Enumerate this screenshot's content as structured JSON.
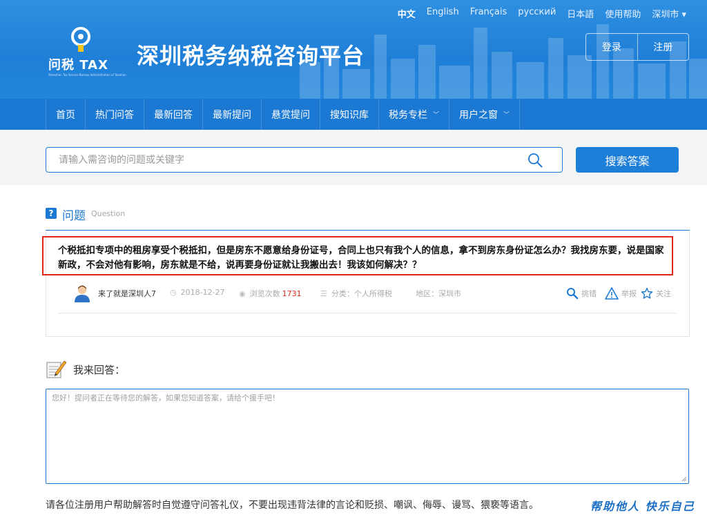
{
  "header": {
    "languages": [
      "中文",
      "English",
      "Français",
      "русский",
      "日本語",
      "使用帮助",
      "深圳市 ▾"
    ],
    "logo_brand": "问税 TAX",
    "logo_tagline": "Shenzhen Tax Service Bureau Administration of Taxation",
    "site_title": "深圳税务纳税咨询平台",
    "login_label": "登录",
    "register_label": "注册"
  },
  "nav": {
    "items": [
      {
        "label": "首页",
        "dropdown": false
      },
      {
        "label": "热门问答",
        "dropdown": false
      },
      {
        "label": "最新回答",
        "dropdown": false
      },
      {
        "label": "最新提问",
        "dropdown": false
      },
      {
        "label": "悬赏提问",
        "dropdown": false
      },
      {
        "label": "搜知识库",
        "dropdown": false
      },
      {
        "label": "税务专栏",
        "dropdown": true
      },
      {
        "label": "用户之窗",
        "dropdown": true
      }
    ]
  },
  "search": {
    "placeholder": "请输入需咨询的问题或关键字",
    "button_label": "搜索答案"
  },
  "question": {
    "section_label": "问题",
    "section_label_en": "Question",
    "badge": "?",
    "text": "个税抵扣专项中的租房享受个税抵扣，但是房东不愿意给身份证号，合同上也只有我个人的信息，拿不到房东身份证怎么办？我找房东要，说是国家新政，不会对他有影响，房东就是不给，说再要身份证就让我搬出去！我该如何解决？？",
    "author": "来了就是深圳人7",
    "date": "2018-12-27",
    "views_label": "浏览次数",
    "views_count": "1731",
    "category": "分类：个人所得税",
    "region": "地区：深圳市",
    "action_correct": "挑错",
    "action_report": "举报",
    "action_follow": "关注"
  },
  "answer": {
    "title": "我来回答：",
    "placeholder": "您好！提问者正在等待您的解答，如果您知道答案，请给个援手吧！",
    "rules": "请各位注册用户帮助解答时自觉遵守问答礼仪，不要出现违背法律的言论和贬损、嘲讽、侮辱、谩骂、猥亵等语言。",
    "slogan": "帮助他人 快乐自己"
  },
  "colors": {
    "brand_blue": "#1b79d4",
    "highlight_red": "#e1251b",
    "views_red": "#e1251b"
  }
}
